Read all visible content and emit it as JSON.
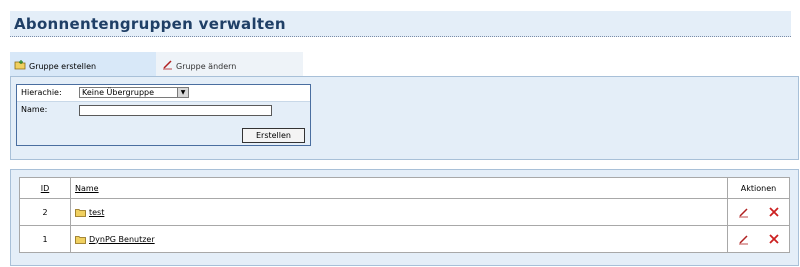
{
  "page": {
    "title": "Abonnentengruppen verwalten"
  },
  "tabs": [
    {
      "label": "Gruppe erstellen",
      "icon": "folder-new-icon",
      "active": true
    },
    {
      "label": "Gruppe ändern",
      "icon": "pencil-icon",
      "active": false
    }
  ],
  "form": {
    "hierarchy_label": "Hierachie:",
    "hierarchy_value": "Keine Übergruppe",
    "name_label": "Name:",
    "name_value": "",
    "submit_label": "Erstellen"
  },
  "table": {
    "headers": {
      "id": "ID",
      "name": "Name",
      "actions": "Aktionen"
    },
    "rows": [
      {
        "id": "2",
        "name": "test"
      },
      {
        "id": "1",
        "name": "DynPG Benutzer"
      }
    ]
  },
  "colors": {
    "title": "#1f3f66",
    "panel_bg": "#e4eef8",
    "delete": "#cc2020",
    "edit": "#b02020"
  }
}
